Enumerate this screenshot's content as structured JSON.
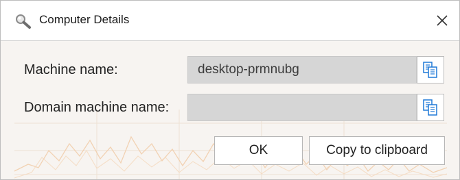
{
  "window": {
    "title": "Computer Details",
    "icon": "magnifier-icon",
    "close_icon": "close-icon"
  },
  "form": {
    "machine_name_label": "Machine name:",
    "machine_name_value": "desktop-prmnubg",
    "domain_machine_name_label": "Domain machine name:",
    "domain_machine_name_value": "",
    "copy_icon": "copy-to-clipboard-icon"
  },
  "buttons": {
    "ok_label": "OK",
    "copy_label": "Copy to clipboard"
  },
  "colors": {
    "field_background": "#d6d6d6",
    "window_background": "#f7f4f1",
    "copy_icon_accent": "#1e78d7"
  }
}
